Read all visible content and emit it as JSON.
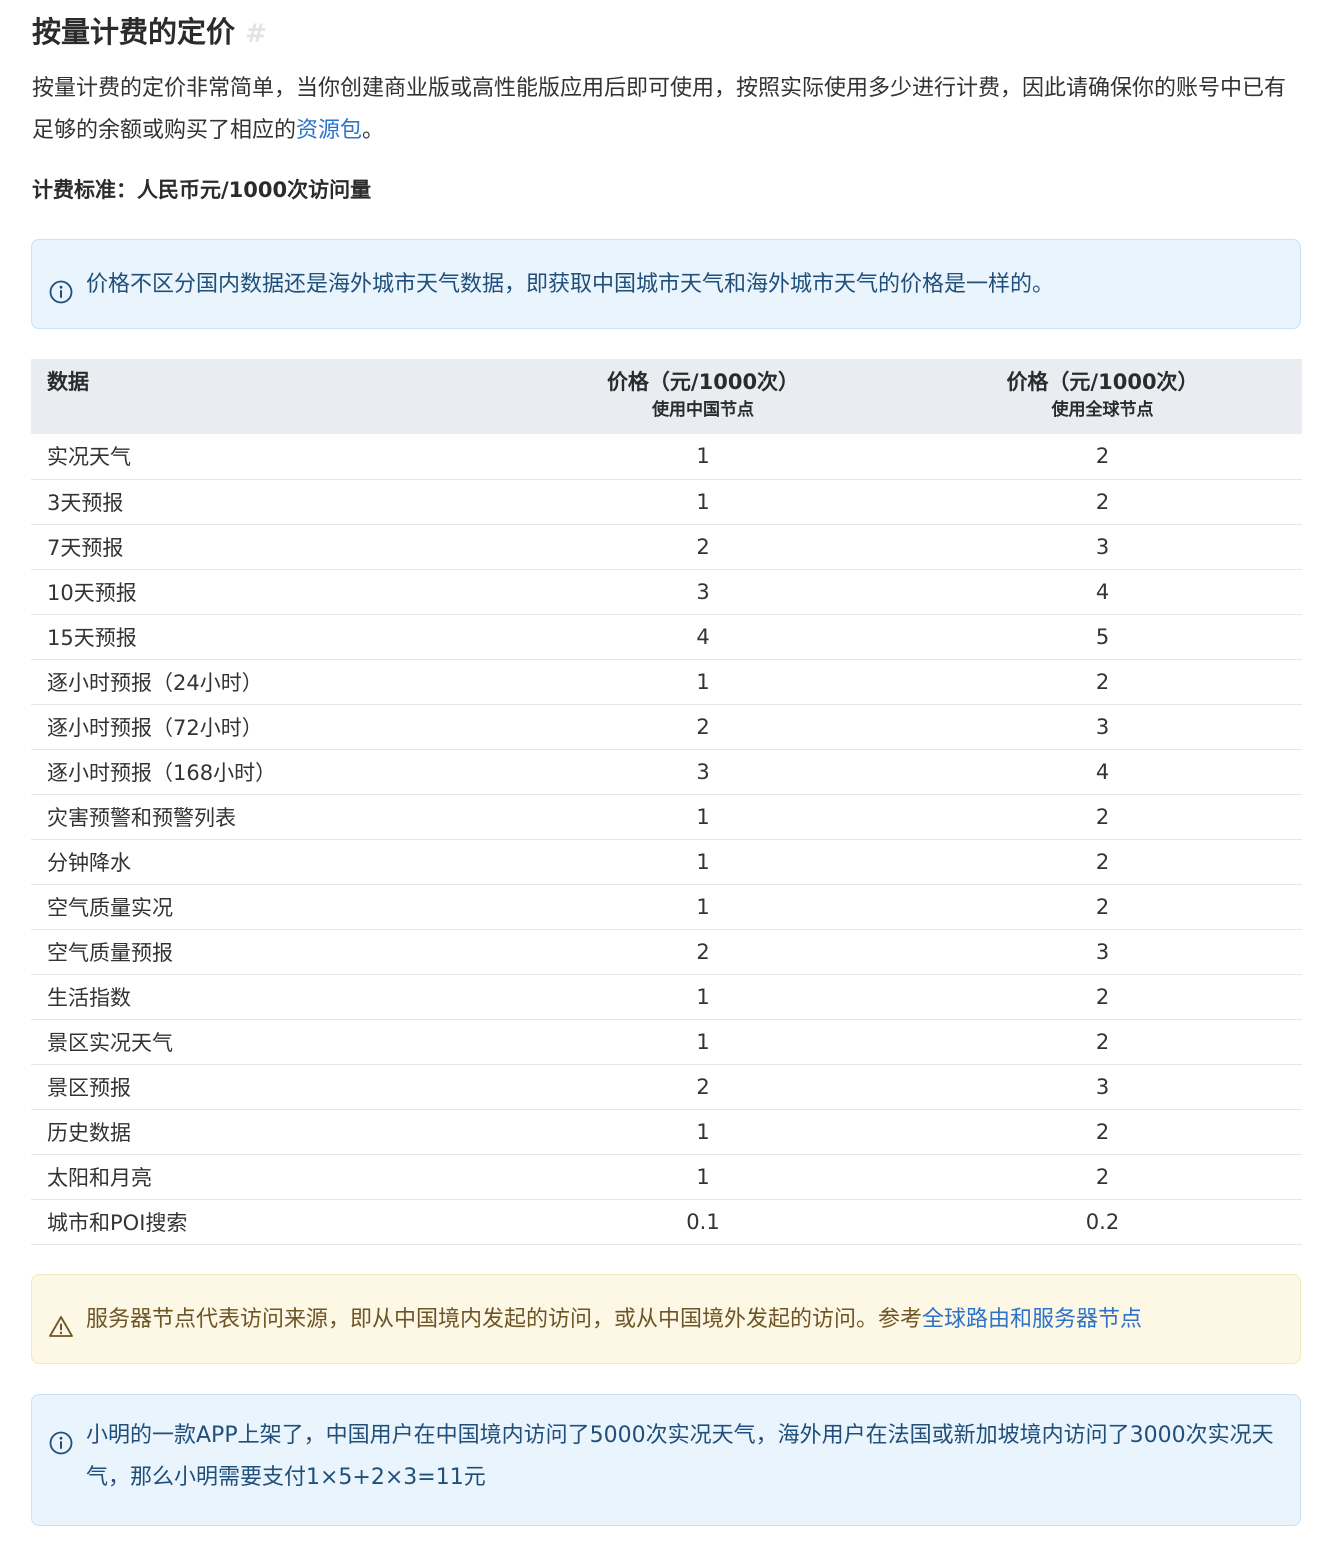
{
  "heading": {
    "title": "按量计费的定价",
    "anchor": "#"
  },
  "intro": {
    "text": "按量计费的定价非常简单，当你创建商业版或高性能版应用后即可使用，按照实际使用多少进行计费，因此请确保你的账号中已有足够的余额或购买了相应的",
    "link": "资源包",
    "tail": "。"
  },
  "standard": "计费标准：人民币元/1000次访问量",
  "callout_info": {
    "text": "价格不区分国内数据还是海外城市天气数据，即获取中国城市天气和海外城市天气的价格是一样的。",
    "icon": "info-circle-icon"
  },
  "table": {
    "headers": [
      {
        "main": "数据"
      },
      {
        "main": "价格（元/1000次）",
        "sub": "使用中国节点"
      },
      {
        "main": "价格（元/1000次）",
        "sub": "使用全球节点"
      }
    ],
    "rows": [
      {
        "name": "实况天气",
        "cn": "1",
        "global": "2"
      },
      {
        "name": "3天预报",
        "cn": "1",
        "global": "2"
      },
      {
        "name": "7天预报",
        "cn": "2",
        "global": "3"
      },
      {
        "name": "10天预报",
        "cn": "3",
        "global": "4"
      },
      {
        "name": "15天预报",
        "cn": "4",
        "global": "5"
      },
      {
        "name": "逐小时预报（24小时）",
        "cn": "1",
        "global": "2"
      },
      {
        "name": "逐小时预报（72小时）",
        "cn": "2",
        "global": "3"
      },
      {
        "name": "逐小时预报（168小时）",
        "cn": "3",
        "global": "4"
      },
      {
        "name": "灾害预警和预警列表",
        "cn": "1",
        "global": "2"
      },
      {
        "name": "分钟降水",
        "cn": "1",
        "global": "2"
      },
      {
        "name": "空气质量实况",
        "cn": "1",
        "global": "2"
      },
      {
        "name": "空气质量预报",
        "cn": "2",
        "global": "3"
      },
      {
        "name": "生活指数",
        "cn": "1",
        "global": "2"
      },
      {
        "name": "景区实况天气",
        "cn": "1",
        "global": "2"
      },
      {
        "name": "景区预报",
        "cn": "2",
        "global": "3"
      },
      {
        "name": "历史数据",
        "cn": "1",
        "global": "2"
      },
      {
        "name": "太阳和月亮",
        "cn": "1",
        "global": "2"
      },
      {
        "name": "城市和POI搜索",
        "cn": "0.1",
        "global": "0.2"
      }
    ]
  },
  "callout_warn": {
    "text": "服务器节点代表访问来源，即从中国境内发起的访问，或从中国境外发起的访问。参考",
    "link": "全球路由和服务器节点",
    "icon": "warning-triangle-icon"
  },
  "callout_example": {
    "text": "小明的一款APP上架了，中国用户在中国境内访问了5000次实况天气，海外用户在法国或新加坡境内访问了3000次实况天气，那么小明需要支付1×5+2×3=11元",
    "icon": "info-circle-icon"
  },
  "colors": {
    "link": "#2c73c9",
    "info_bg": "#eaf4fc",
    "info_text": "#1f4f7a",
    "warn_bg": "#fdf7e6",
    "warn_text": "#6e5624",
    "table_header_bg": "#e9edf1"
  }
}
